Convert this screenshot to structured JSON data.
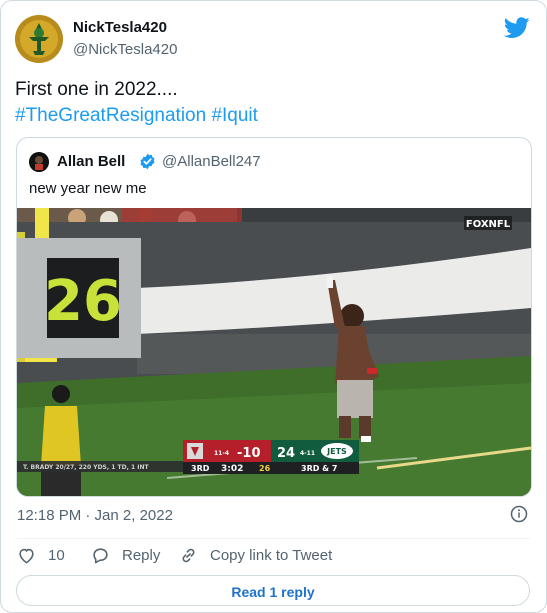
{
  "tweet": {
    "author_name": "NickTesla420",
    "author_handle": "@NickTesla420",
    "text_line1": "First one in 2022....",
    "hashtag1": "#TheGreatResignation",
    "hashtag2": "#Iquit",
    "timestamp": "12:18 PM · Jan 2, 2022",
    "like_count": "10",
    "reply_label": "Reply",
    "copy_link_label": "Copy link to Tweet",
    "read_replies_label": "Read 1 reply"
  },
  "quoted": {
    "author_name": "Allan Bell",
    "author_handle": "@AllanBell247",
    "text": "new year new me"
  },
  "scoreboard": {
    "network_bug": "FOXNFL",
    "wall_number": "26",
    "tb_record": "11-4",
    "spread": "-10",
    "tb_score": "24",
    "nyj_record": "4-11",
    "qb_line": "T. BRADY 20/27, 220 YDS, 1 TD, 1 INT",
    "quarter": "3RD",
    "clock": "3:02",
    "play_clock": "26",
    "down": "3RD & 7"
  },
  "colors": {
    "link": "#1d9bf0",
    "twitter_blue": "#1d9bf0",
    "verified_blue": "#1d9bf0",
    "field_green": "#3e6e2a",
    "tb_red": "#b41f2a",
    "nyj_green": "#115c3f"
  },
  "icons": [
    "twitter-bird-icon",
    "verified-badge-icon",
    "info-icon",
    "heart-icon",
    "reply-icon",
    "link-icon"
  ]
}
